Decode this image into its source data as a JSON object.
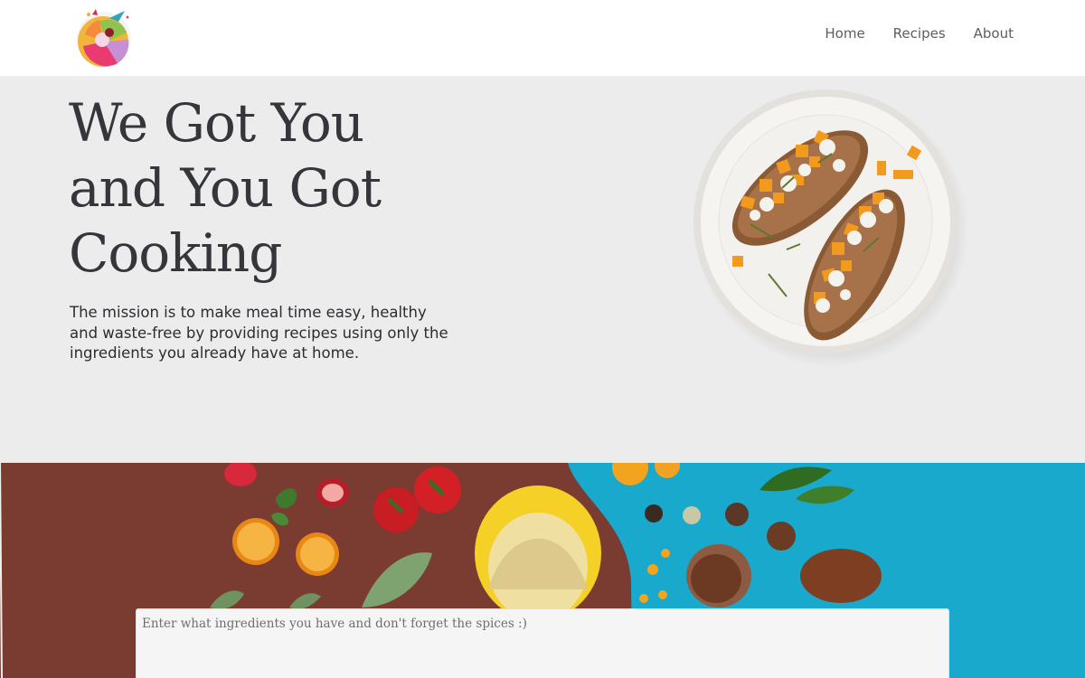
{
  "header": {
    "logo_icon": "fruit-logo-icon",
    "nav": [
      {
        "label": "Home"
      },
      {
        "label": "Recipes"
      },
      {
        "label": "About"
      }
    ]
  },
  "hero": {
    "title_lines": [
      "We Got You",
      "and You Got",
      "Cooking"
    ],
    "mission_text": "The mission is to make meal time easy, healthy and waste-free by providing recipes using only the ingredients you already have at home.",
    "image_icon": "food-plate-image"
  },
  "ingredients": {
    "image_icon": "ingredients-background-image",
    "input_value": "",
    "input_placeholder": "Enter what ingredients you have and don't forget the spices :)"
  },
  "colors": {
    "hero_background": "#ececec",
    "text_dark": "#34363b",
    "nav_text": "#5b5d63",
    "brown_surface": "#7a3b31",
    "blue_surface": "#18a9cc",
    "pumpkin": "#f29a1d"
  }
}
